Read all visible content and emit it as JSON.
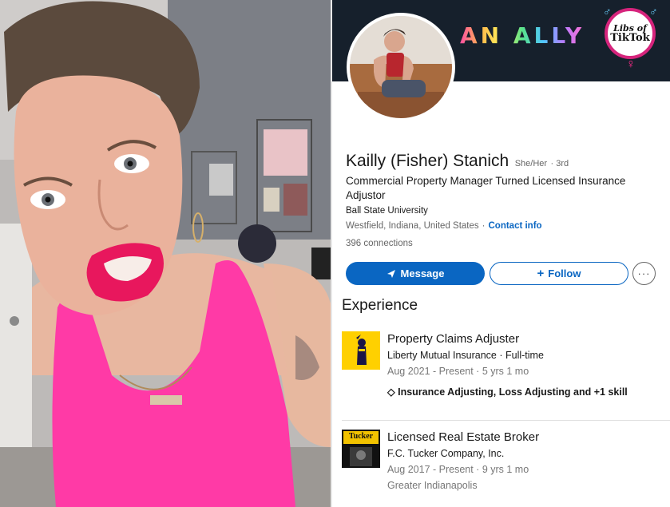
{
  "linkedin": {
    "banner_text": "AN ALLY",
    "watermark": {
      "line1": "Libs of",
      "line2": "TikTok"
    },
    "profile": {
      "name": "Kailly (Fisher) Stanich",
      "pronouns": "She/Her",
      "degree": "· 3rd",
      "headline": "Commercial Property Manager Turned Licensed Insurance Adjustor",
      "school": "Ball State University",
      "location": "Westfield, Indiana, United States",
      "contact_info": "Contact info",
      "connections": "396 connections"
    },
    "actions": {
      "message_label": "Message",
      "follow_label": "Follow",
      "more_label": "···"
    },
    "experience": {
      "heading": "Experience",
      "jobs": [
        {
          "title": "Property Claims Adjuster",
          "company": "Liberty Mutual Insurance · Full-time",
          "dates": "Aug 2021 - Present · 5 yrs 1 mo",
          "skills": "Insurance Adjusting, Loss Adjusting and +1 skill"
        },
        {
          "title": "Licensed Real Estate Broker",
          "company": "F.C. Tucker Company, Inc.",
          "dates": "Aug 2017 - Present · 9 yrs 1 mo",
          "location": "Greater Indianapolis",
          "logo_text": "Tucker"
        }
      ]
    }
  },
  "colors": {
    "linkedin_blue": "#0a66c2",
    "banner_bg": "#16202c",
    "tank_top": "#ff3aa6",
    "lipstick": "#e8175d"
  }
}
